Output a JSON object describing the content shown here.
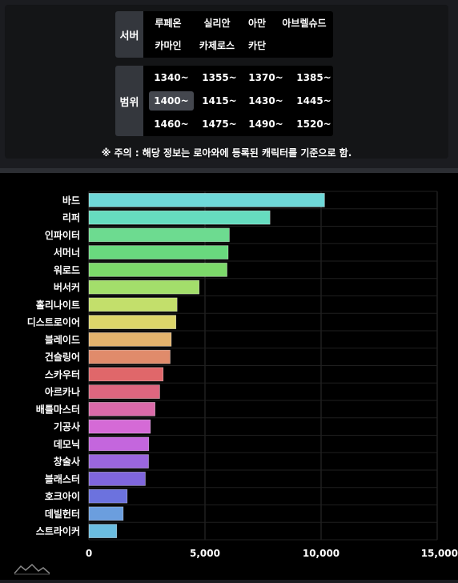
{
  "filters": {
    "server": {
      "label": "서버",
      "options": [
        "루페온",
        "실리안",
        "아만",
        "아브렐슈드",
        "카마인",
        "카제로스",
        "카단"
      ],
      "selected": null
    },
    "range": {
      "label": "범위",
      "options": [
        "1340~",
        "1355~",
        "1370~",
        "1385~",
        "1400~",
        "1415~",
        "1430~",
        "1445~",
        "1460~",
        "1475~",
        "1490~",
        "1520~"
      ],
      "selected": "1400~"
    },
    "notice": "※ 주의 : 해당 정보는 로아와에 등록된 캐릭터를 기준으로 함."
  },
  "colors": {
    "selected_bg": "#44474e",
    "label_bg": "#34373d"
  },
  "chart_data": {
    "type": "bar",
    "orientation": "horizontal",
    "categories": [
      "바드",
      "리퍼",
      "인파이터",
      "서머너",
      "워로드",
      "버서커",
      "홀리나이트",
      "디스트로이어",
      "블레이드",
      "건슬링어",
      "스카우터",
      "아르카나",
      "배틀마스터",
      "기공사",
      "데모닉",
      "창술사",
      "블래스터",
      "호크아이",
      "데빌헌터",
      "스트라이커"
    ],
    "values": [
      10150,
      7800,
      6050,
      6000,
      5950,
      4750,
      3800,
      3750,
      3550,
      3500,
      3200,
      3050,
      2850,
      2650,
      2580,
      2570,
      2430,
      1650,
      1480,
      1200
    ],
    "colors": [
      "#6fd9d9",
      "#66dcbf",
      "#6ddb90",
      "#69d97e",
      "#7cd96a",
      "#a3de6b",
      "#c3df6b",
      "#dcd56a",
      "#e3b36d",
      "#e08b6b",
      "#e0676a",
      "#dd667f",
      "#db6aa9",
      "#d56ad6",
      "#c466dd",
      "#9a66dd",
      "#7f66dd",
      "#6c72de",
      "#6b9ede",
      "#6bbde0"
    ],
    "xticks": [
      "0",
      "5,000",
      "10,000",
      "15,000"
    ],
    "xlim": [
      0,
      15000
    ],
    "grid": true
  }
}
